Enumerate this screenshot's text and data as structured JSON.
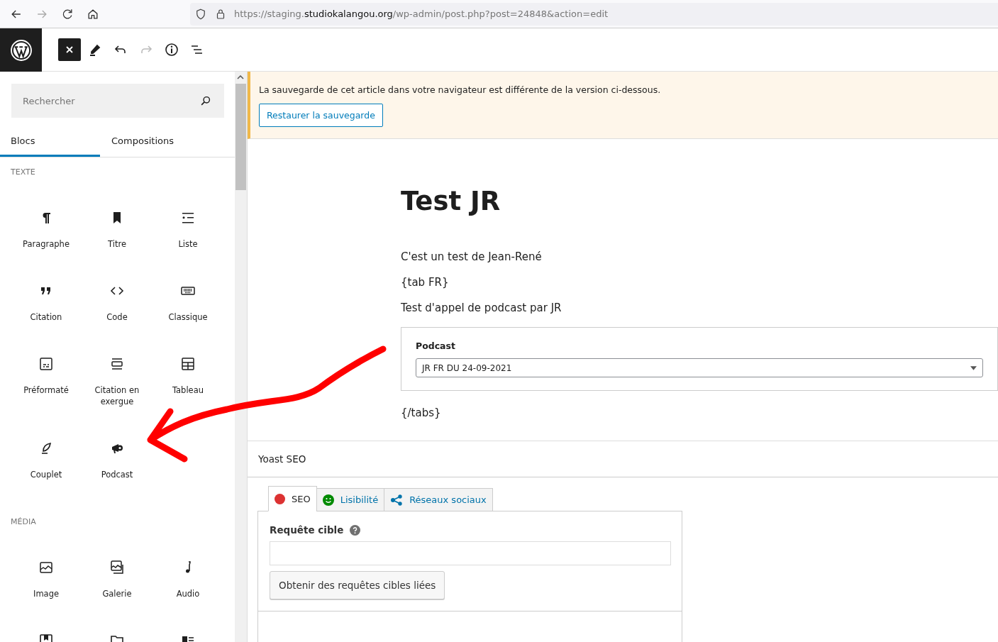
{
  "browser": {
    "nav": [
      {
        "kind": "back",
        "disabled": false
      },
      {
        "kind": "forward",
        "disabled": true
      },
      {
        "kind": "reload",
        "disabled": false
      },
      {
        "kind": "home",
        "disabled": false
      }
    ],
    "url_start": "https://staging.",
    "url_domain": "studiokalangou.org",
    "url_rest": "/wp-admin/post.php?post=24848&action=edit"
  },
  "toolbar": {
    "tools": [
      {
        "kind": "close",
        "disabled": false
      },
      {
        "kind": "pen",
        "disabled": false
      },
      {
        "kind": "undo",
        "disabled": false
      },
      {
        "kind": "redo",
        "disabled": true
      },
      {
        "kind": "info",
        "disabled": false
      },
      {
        "kind": "outline",
        "disabled": false
      }
    ]
  },
  "sidebar": {
    "search": {
      "placeholder": "Rechercher"
    },
    "tabs": [
      {
        "label": "Blocs",
        "selected": true
      },
      {
        "label": "Compositions",
        "selected": false
      }
    ],
    "sections": [
      {
        "title": "TEXTE",
        "blocks": [
          {
            "label": "Paragraphe",
            "kind": "paragraph"
          },
          {
            "label": "Titre",
            "kind": "heading"
          },
          {
            "label": "Liste",
            "kind": "list"
          },
          {
            "label": "Citation",
            "kind": "quote"
          },
          {
            "label": "Code",
            "kind": "code"
          },
          {
            "label": "Classique",
            "kind": "classic"
          },
          {
            "label": "Préformaté",
            "kind": "preformatted"
          },
          {
            "label": "Citation en exergue",
            "kind": "pullquote"
          },
          {
            "label": "Tableau",
            "kind": "table"
          },
          {
            "label": "Couplet",
            "kind": "verse"
          },
          {
            "label": "Podcast",
            "kind": "megaphone"
          }
        ]
      },
      {
        "title": "MÉDIA",
        "blocks": [
          {
            "label": "Image",
            "kind": "image"
          },
          {
            "label": "Galerie",
            "kind": "gallery"
          },
          {
            "label": "Audio",
            "kind": "audio"
          },
          {
            "kind": "cover"
          },
          {
            "kind": "file"
          },
          {
            "kind": "mediatext"
          }
        ]
      }
    ]
  },
  "editor": {
    "notice": {
      "text": "La sauvegarde de cet article dans votre navigateur est différente de la version ci-dessous.",
      "button": "Restaurer la sauvegarde"
    },
    "title": "Test JR",
    "paragraphs_before": [
      "C'est un test de Jean-René",
      "{tab FR}",
      "Test d'appel de podcast par JR"
    ],
    "podcast_block": {
      "label": "Podcast",
      "value": "JR FR DU 24-09-2021"
    },
    "paragraphs_after": [
      "{/tabs}"
    ]
  },
  "yoast": {
    "title": "Yoast SEO",
    "tabs": [
      {
        "label": "SEO",
        "kind": "dot",
        "color": "#dc3232",
        "selected": true
      },
      {
        "label": "Lisibilité",
        "kind": "smiley",
        "color": "#008a00",
        "selected": false
      },
      {
        "label": "Réseaux sociaux",
        "kind": "share",
        "selected": false
      }
    ],
    "keyphrase_label": "Requête cible",
    "related_button": "Obtenir des requêtes cibles liées"
  }
}
